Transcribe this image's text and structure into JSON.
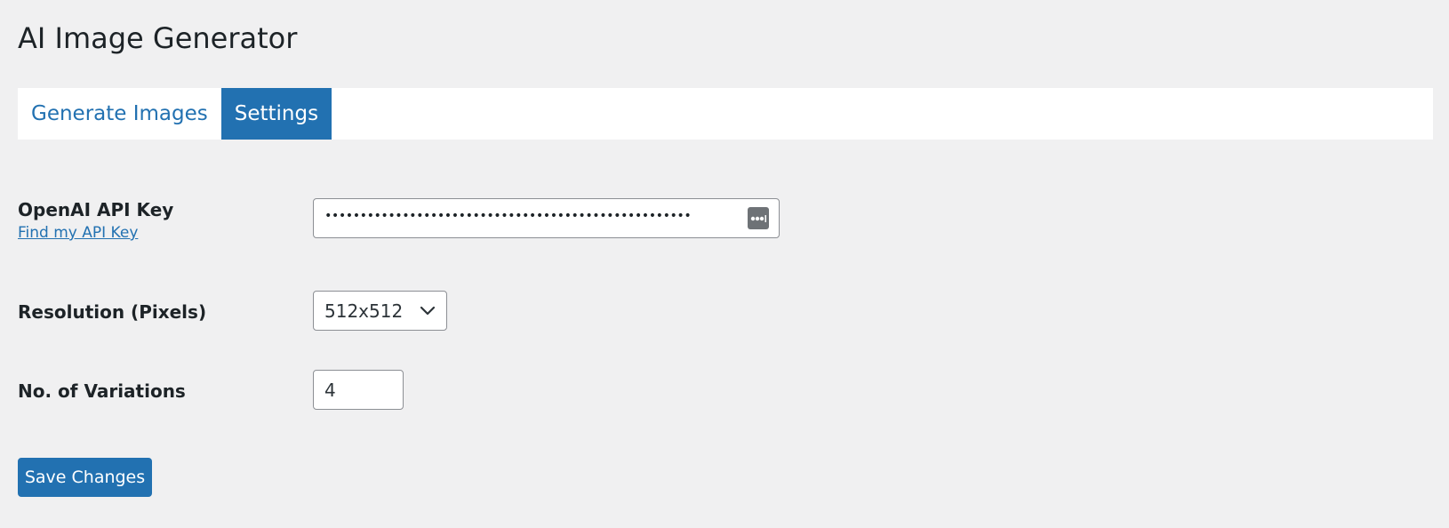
{
  "page": {
    "title": "AI Image Generator"
  },
  "tabs": [
    {
      "label": "Generate Images",
      "active": false
    },
    {
      "label": "Settings",
      "active": true
    }
  ],
  "settings": {
    "api_key": {
      "label": "OpenAI API Key",
      "help_link": "Find my API Key",
      "value_masked": "••••••••••••••••••••••••••••••••••••••••••••••••••••",
      "reveal_icon": "password-dots-icon"
    },
    "resolution": {
      "label": "Resolution (Pixels)",
      "selected": "512x512",
      "icon": "chevron-down-icon"
    },
    "variations": {
      "label": "No. of Variations",
      "value": "4"
    }
  },
  "actions": {
    "save_label": "Save Changes"
  },
  "colors": {
    "accent": "#2271b1",
    "background": "#f0f0f1",
    "text": "#1d2327"
  }
}
